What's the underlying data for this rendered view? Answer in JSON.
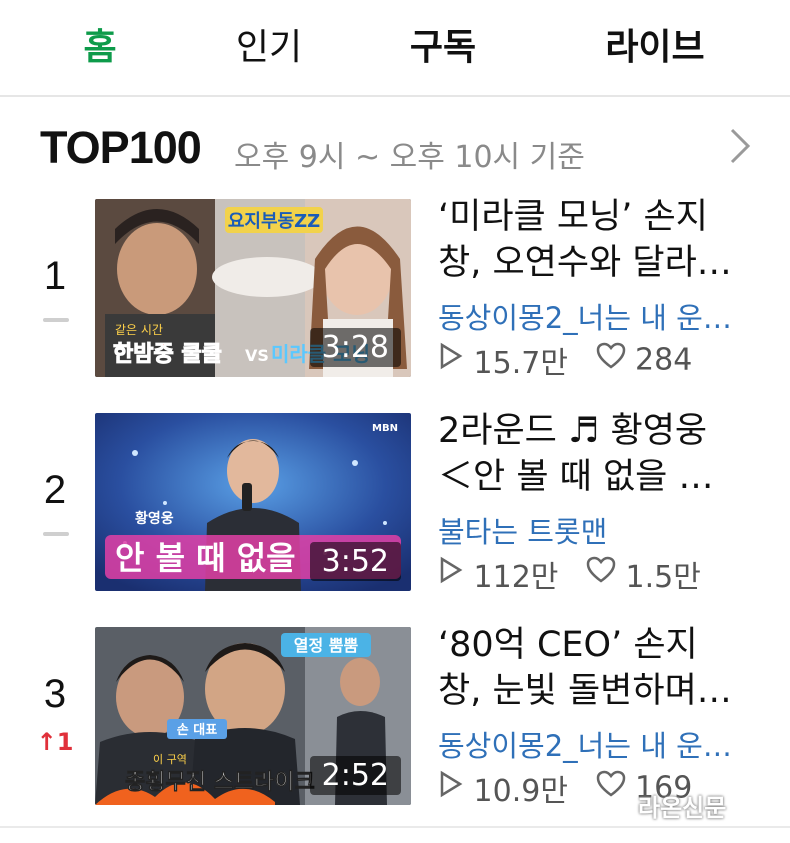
{
  "tabs": [
    {
      "label": "홈",
      "active": true
    },
    {
      "label": "인기",
      "active": false
    },
    {
      "label": "구독",
      "active": false
    },
    {
      "label": "라이브",
      "active": false
    }
  ],
  "section": {
    "title": "TOP100",
    "subtitle": "오후 9시 ~ 오후 10시 기준",
    "more_icon": "chevron-right-icon"
  },
  "items": [
    {
      "rank": "1",
      "rank_change": "",
      "title_line1": "‘미라클 모닝’ 손지",
      "title_line2": "창, 오연수와 달라…",
      "channel": "동상이몽2_너는 내 운…",
      "views": "15.7만",
      "likes": "284",
      "duration": "3:28",
      "thumb_texts": [
        "요지부동ZZ",
        "같은 시간",
        "한밤중 쿨쿨",
        "VS",
        "미라클 모닝"
      ]
    },
    {
      "rank": "2",
      "rank_change": "",
      "title_line1": "2라운드 ♬ 황영웅",
      "title_line2": "＜안 볼 때 없을 …",
      "channel": "불타는 트롯맨",
      "views": "112만",
      "likes": "1.5만",
      "duration": "3:52",
      "thumb_texts": [
        "MBN",
        "황영웅",
        "안 볼 때 없을"
      ]
    },
    {
      "rank": "3",
      "rank_change": "↑1",
      "title_line1": "‘80억 CEO’ 손지",
      "title_line2": "창, 눈빛 돌변하며…",
      "channel": "동상이몽2_너는 내 운…",
      "views": "10.9만",
      "likes": "169",
      "duration": "2:52",
      "thumb_texts": [
        "열정 뿜뿜",
        "손 대표",
        "이 구역",
        "종횡무진 스트라이크"
      ]
    }
  ],
  "watermark": "라온신문",
  "colors": {
    "active_tab": "#0d9b4a",
    "channel": "#2f70b8",
    "rank_up": "#e0303a",
    "subtitle": "#8a8a8a"
  }
}
